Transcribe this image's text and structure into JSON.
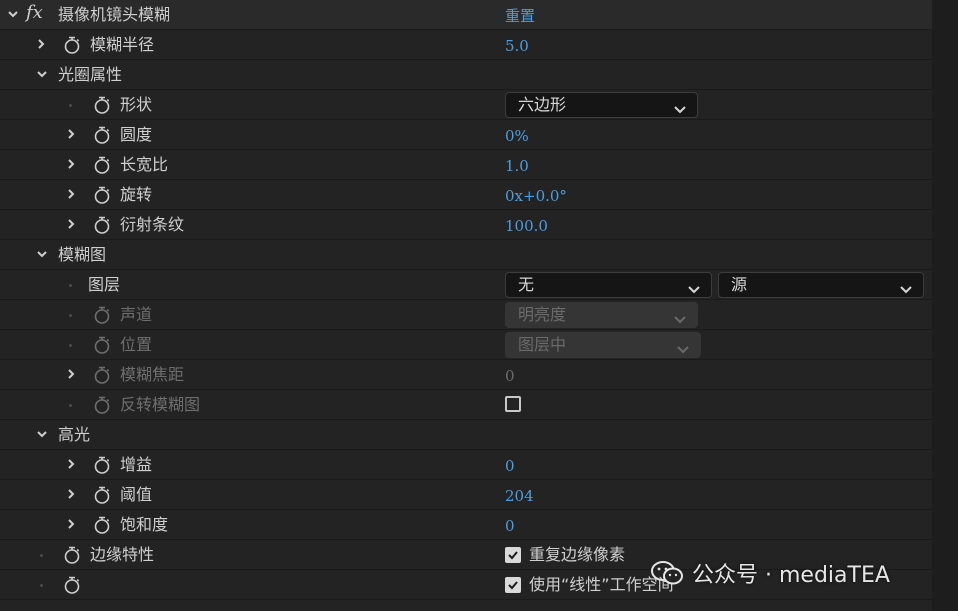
{
  "effect": {
    "name": "摄像机镜头模糊",
    "reset_label": "重置"
  },
  "rows": {
    "blur_radius": {
      "label": "模糊半径",
      "value": "5.0"
    },
    "iris_group": {
      "label": "光圈属性"
    },
    "shape": {
      "label": "形状",
      "selected": "六边形"
    },
    "roundness": {
      "label": "圆度",
      "value": "0%"
    },
    "aspect_ratio": {
      "label": "长宽比",
      "value": "1.0"
    },
    "rotation": {
      "label": "旋转",
      "value": "0x+0.0°"
    },
    "diffraction": {
      "label": "衍射条纹",
      "value": "100.0"
    },
    "blur_map_group": {
      "label": "模糊图"
    },
    "layer": {
      "label": "图层",
      "selected": "无",
      "source_selected": "源"
    },
    "channel": {
      "label": "声道",
      "selected": "明亮度"
    },
    "placement": {
      "label": "位置",
      "selected": "图层中"
    },
    "blur_focal_distance": {
      "label": "模糊焦距",
      "value": "0"
    },
    "invert_blur_map": {
      "label": "反转模糊图"
    },
    "highlight_group": {
      "label": "高光"
    },
    "gain": {
      "label": "增益",
      "value": "0"
    },
    "threshold": {
      "label": "阈值",
      "value": "204"
    },
    "saturation": {
      "label": "饱和度",
      "value": "0"
    },
    "edge_behavior": {
      "label": "边缘特性",
      "checkbox_label": "重复边缘像素"
    },
    "linear_working_space": {
      "checkbox_label": "使用“线性”工作空间"
    }
  },
  "watermark": {
    "text": "公众号 · mediaTEA"
  },
  "colors": {
    "value_blue": "#4d9de0",
    "panel_bg": "#232323",
    "disabled_text": "#6e6e6e"
  }
}
